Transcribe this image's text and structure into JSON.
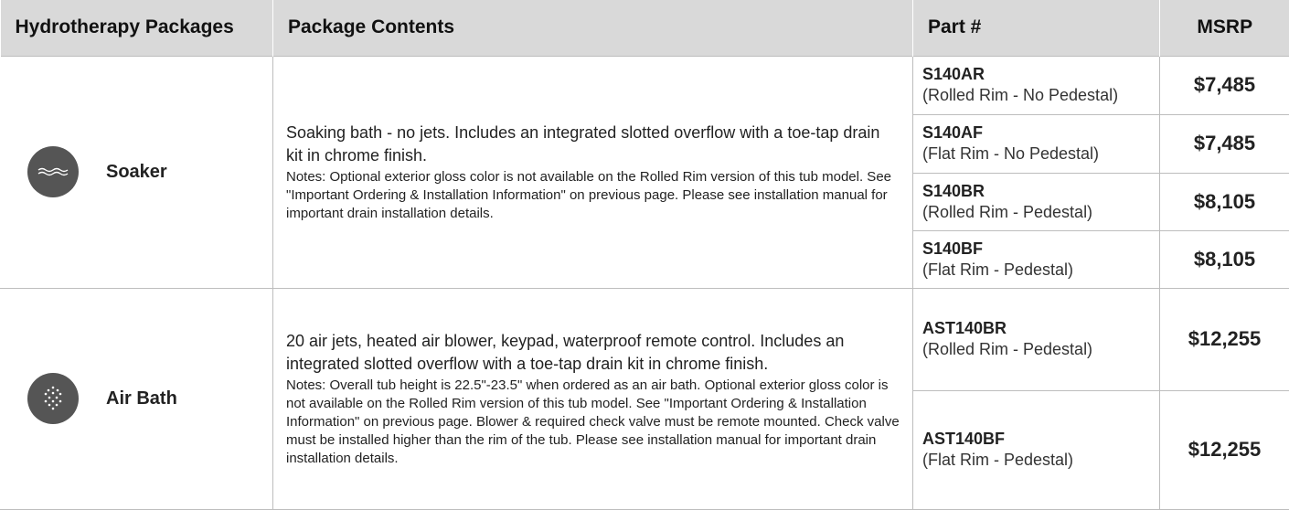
{
  "headers": {
    "packages": "Hydrotherapy Packages",
    "contents": "Package Contents",
    "part": "Part #",
    "msrp": "MSRP"
  },
  "packages": [
    {
      "name": "Soaker",
      "icon": "wave-icon",
      "contents": "Soaking bath - no jets. Includes an integrated slotted overflow with a toe-tap drain kit in chrome finish.",
      "notes": "Notes: Optional exterior gloss color is not available on the Rolled Rim version of this tub model. See \"Important Ordering & Installation Information\" on previous page. Please see installation manual for important drain installation details.",
      "parts": [
        {
          "number": "S140AR",
          "desc": "(Rolled Rim - No Pedestal)",
          "price": "$7,485"
        },
        {
          "number": "S140AF",
          "desc": "(Flat Rim - No Pedestal)",
          "price": "$7,485"
        },
        {
          "number": "S140BR",
          "desc": "(Rolled Rim - Pedestal)",
          "price": "$8,105"
        },
        {
          "number": "S140BF",
          "desc": "(Flat Rim - Pedestal)",
          "price": "$8,105"
        }
      ]
    },
    {
      "name": "Air Bath",
      "icon": "air-bubbles-icon",
      "contents": "20 air jets, heated air blower, keypad, waterproof remote control. Includes an integrated slotted overflow with a toe-tap drain kit in chrome finish.",
      "notes": "Notes: Overall tub height is 22.5\"-23.5\" when ordered as an air bath. Optional exterior gloss color is not available on the Rolled Rim version of this tub model. See \"Important Ordering & Installation Information\" on previous page. Blower & required check valve must be remote mounted. Check valve must be installed higher than the rim of the tub. Please see installation manual for important drain installation details.",
      "parts": [
        {
          "number": "AST140BR",
          "desc": "(Rolled Rim - Pedestal)",
          "price": "$12,255"
        },
        {
          "number": "AST140BF",
          "desc": "(Flat Rim - Pedestal)",
          "price": "$12,255"
        }
      ]
    }
  ],
  "colors": {
    "header_bg": "#d9d9d9",
    "icon_bg": "#555555",
    "grid": "#bdbdbd"
  }
}
